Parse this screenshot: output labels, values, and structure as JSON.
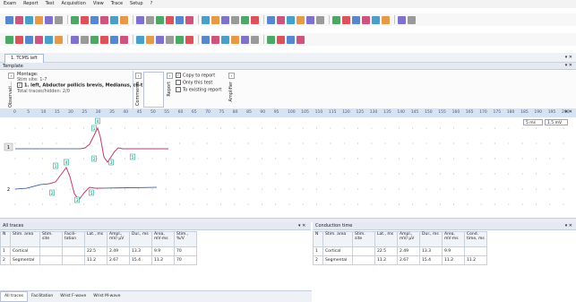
{
  "menu": [
    "Exam",
    "Report",
    "Test",
    "Acquisition",
    "View",
    "Trace",
    "Setup",
    "?"
  ],
  "document_tab": "1. TCMS left",
  "template_panel": {
    "title": "Template",
    "montage_label": "Montage:",
    "stim_site": "Stim site: 1-7",
    "montage_item": "1. left, Abductor pollicis brevis, Medianus, c6-t1",
    "total_traces": "Total traces/hidden: 2/0",
    "side_obs": "Observati...",
    "side_comments": "Comments",
    "side_report": "Report",
    "side_amplifier": "Amplifier",
    "copy_to_report": "Copy to report",
    "only_this_test": "Only this test",
    "to_existing_report": "To existing report"
  },
  "ruler_ticks": [
    "0",
    "5",
    "10",
    "15",
    "20",
    "25",
    "30",
    "35",
    "40",
    "45",
    "50",
    "55",
    "60",
    "65",
    "70",
    "75",
    "80",
    "85",
    "90",
    "95",
    "100",
    "105",
    "110",
    "115",
    "120",
    "125",
    "130",
    "135",
    "140",
    "145",
    "150",
    "155",
    "160",
    "165",
    "170",
    "175",
    "180",
    "185",
    "190",
    "195",
    "200"
  ],
  "plot": {
    "timebase": "5 ms",
    "sensitivity": "1.5 mV",
    "trace_labels": [
      "1",
      "2"
    ],
    "marker_labels_1": [
      "1",
      "4",
      "2",
      "3",
      "5"
    ],
    "marker_labels_2": [
      "1",
      "4",
      "2",
      "3",
      "5"
    ]
  },
  "all_traces": {
    "title": "All traces",
    "headers": [
      "N",
      "Stim. area",
      "Stim. site",
      "Facili-tation",
      "Lat., ms",
      "Ampl., mV/ μV",
      "Dur., ms",
      "Area, mV·ms",
      "Stim., %/V"
    ],
    "rows": [
      [
        "1",
        "Cortical",
        "",
        "",
        "22.5",
        "2.49",
        "13.3",
        "9.9",
        "70"
      ],
      [
        "2",
        "Segmental",
        "",
        "",
        "11.2",
        "2.67",
        "15.4",
        "11.2",
        "70"
      ]
    ]
  },
  "conduction": {
    "title": "Conduction time",
    "headers": [
      "N",
      "Stim. area",
      "Stim. site",
      "Lat., ms",
      "Ampl., mV/ μV",
      "Dur., ms",
      "Area, mV·ms",
      "Cond. time, ms"
    ],
    "rows": [
      [
        "1",
        "Cortical",
        "",
        "22.5",
        "2.49",
        "13.3",
        "9.9",
        ""
      ],
      [
        "2",
        "Segmental",
        "",
        "11.2",
        "2.67",
        "15.4",
        "11.2",
        "11.2"
      ]
    ]
  },
  "footer_tabs": [
    "All traces",
    "Facilitation",
    "Wrist F-wave",
    "Wrist M-wave"
  ],
  "colors": {
    "accent": "#c23a6a",
    "trace": "#1f4a8a",
    "marker": "#1aa68a"
  }
}
